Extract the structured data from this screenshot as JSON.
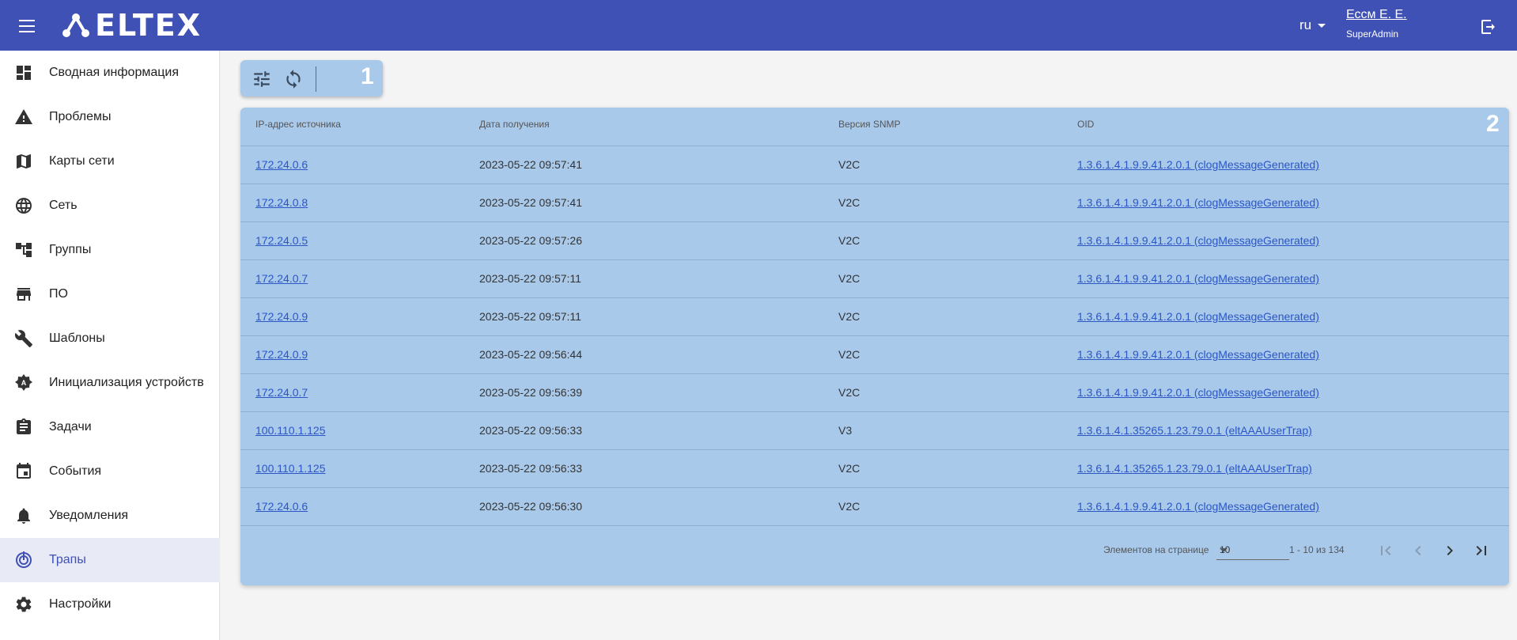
{
  "header": {
    "logo_text": "ELTEX",
    "lang": "ru",
    "user_name": "Ессм Е. Е.",
    "user_role": "SuperAdmin",
    "brand_color": "#3f51b5"
  },
  "sidebar": {
    "items": [
      {
        "label": "Сводная информация",
        "icon": "dashboard-icon"
      },
      {
        "label": "Проблемы",
        "icon": "warning-icon"
      },
      {
        "label": "Карты сети",
        "icon": "map-icon"
      },
      {
        "label": "Сеть",
        "icon": "globe-icon"
      },
      {
        "label": "Группы",
        "icon": "tree-icon"
      },
      {
        "label": "ПО",
        "icon": "store-icon"
      },
      {
        "label": "Шаблоны",
        "icon": "wrench-icon"
      },
      {
        "label": "Инициализация устройств",
        "icon": "gear-badge-icon"
      },
      {
        "label": "Задачи",
        "icon": "clipboard-icon"
      },
      {
        "label": "События",
        "icon": "calendar-icon"
      },
      {
        "label": "Уведомления",
        "icon": "bell-icon"
      },
      {
        "label": "Трапы",
        "icon": "trap-icon",
        "active": true
      },
      {
        "label": "Настройки",
        "icon": "gear-icon"
      }
    ]
  },
  "toolbar": {
    "filter_icon": "tune-icon",
    "refresh_icon": "refresh-icon",
    "marker": "1"
  },
  "table": {
    "marker": "2",
    "columns": [
      "IP-адрес источника",
      "Дата получения",
      "Версия SNMP",
      "OID"
    ],
    "rows": [
      [
        "172.24.0.6",
        "2023-05-22 09:57:41",
        "V2C",
        "1.3.6.1.4.1.9.9.41.2.0.1 (clogMessageGenerated)"
      ],
      [
        "172.24.0.8",
        "2023-05-22 09:57:41",
        "V2C",
        "1.3.6.1.4.1.9.9.41.2.0.1 (clogMessageGenerated)"
      ],
      [
        "172.24.0.5",
        "2023-05-22 09:57:26",
        "V2C",
        "1.3.6.1.4.1.9.9.41.2.0.1 (clogMessageGenerated)"
      ],
      [
        "172.24.0.7",
        "2023-05-22 09:57:11",
        "V2C",
        "1.3.6.1.4.1.9.9.41.2.0.1 (clogMessageGenerated)"
      ],
      [
        "172.24.0.9",
        "2023-05-22 09:57:11",
        "V2C",
        "1.3.6.1.4.1.9.9.41.2.0.1 (clogMessageGenerated)"
      ],
      [
        "172.24.0.9",
        "2023-05-22 09:56:44",
        "V2C",
        "1.3.6.1.4.1.9.9.41.2.0.1 (clogMessageGenerated)"
      ],
      [
        "172.24.0.7",
        "2023-05-22 09:56:39",
        "V2C",
        "1.3.6.1.4.1.9.9.41.2.0.1 (clogMessageGenerated)"
      ],
      [
        "100.110.1.125",
        "2023-05-22 09:56:33",
        "V3",
        "1.3.6.1.4.1.35265.1.23.79.0.1 (eltAAAUserTrap)"
      ],
      [
        "100.110.1.125",
        "2023-05-22 09:56:33",
        "V2C",
        "1.3.6.1.4.1.35265.1.23.79.0.1 (eltAAAUserTrap)"
      ],
      [
        "172.24.0.6",
        "2023-05-22 09:56:30",
        "V2C",
        "1.3.6.1.4.1.9.9.41.2.0.1 (clogMessageGenerated)"
      ]
    ]
  },
  "pagination": {
    "per_page_label": "Элементов на странице",
    "per_page_value": "10",
    "range_label": "1 - 10 из 134"
  }
}
